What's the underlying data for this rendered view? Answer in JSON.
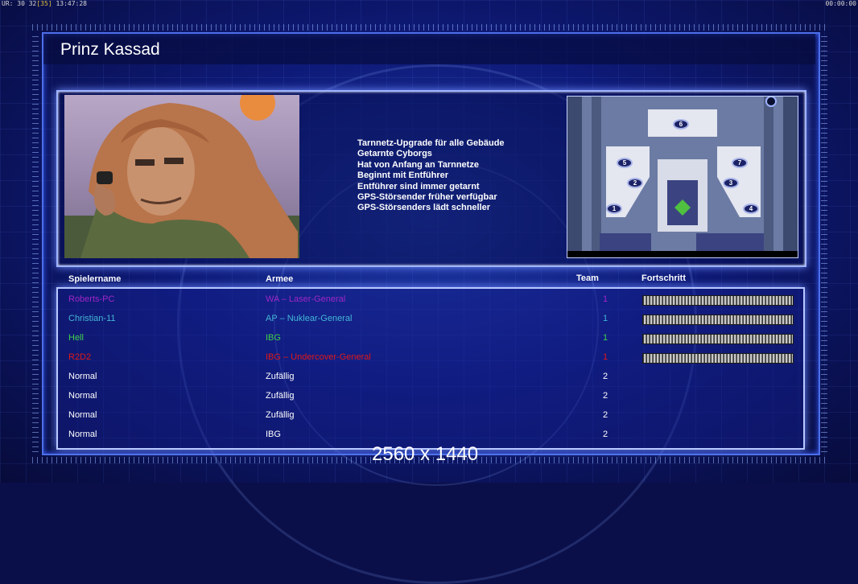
{
  "status": {
    "left_text": "UR: 30 32",
    "left_bracket": "[35]",
    "left_time": "13:47:28",
    "right_text": "00:00:00"
  },
  "title": "Prinz Kassad",
  "features": [
    "Tarnnetz-Upgrade für alle Gebäude",
    "Getarnte Cyborgs",
    "Hat von Anfang an Tarnnetze",
    "Beginnt mit Entführer",
    "Entführer sind immer getarnt",
    "GPS-Störsender früher verfügbar",
    "GPS-Störsenders lädt schneller"
  ],
  "minimap": {
    "slots": [
      "1",
      "2",
      "3",
      "4",
      "5",
      "6",
      "7"
    ]
  },
  "table": {
    "headers": {
      "name": "Spielername",
      "army": "Armee",
      "team": "Team",
      "progress": "Fortschritt"
    },
    "rows": [
      {
        "name": "Roberts-PC",
        "army": "WA – Laser-General",
        "team": "1",
        "color": "#a026c8",
        "progress": 1.0
      },
      {
        "name": "Christian-11",
        "army": "AP – Nuklear-General",
        "team": "1",
        "color": "#43b6d6",
        "progress": 1.0
      },
      {
        "name": "Hell",
        "army": "IBG",
        "team": "1",
        "color": "#3fd04a",
        "progress": 1.0
      },
      {
        "name": "R2D2",
        "army": "IBG – Undercover-General",
        "team": "1",
        "color": "#e01818",
        "progress": 1.0
      },
      {
        "name": "Normal",
        "army": "Zufällig",
        "team": "2",
        "color": "#ffffff",
        "progress": null
      },
      {
        "name": "Normal",
        "army": "Zufällig",
        "team": "2",
        "color": "#ffffff",
        "progress": null
      },
      {
        "name": "Normal",
        "army": "Zufällig",
        "team": "2",
        "color": "#ffffff",
        "progress": null
      },
      {
        "name": "Normal",
        "army": "IBG",
        "team": "2",
        "color": "#ffffff",
        "progress": null
      }
    ]
  },
  "resolution_label": "2560 x 1440",
  "colors": {
    "frame": "#4d6fe8",
    "panel_glow": "#9fb4ff"
  }
}
